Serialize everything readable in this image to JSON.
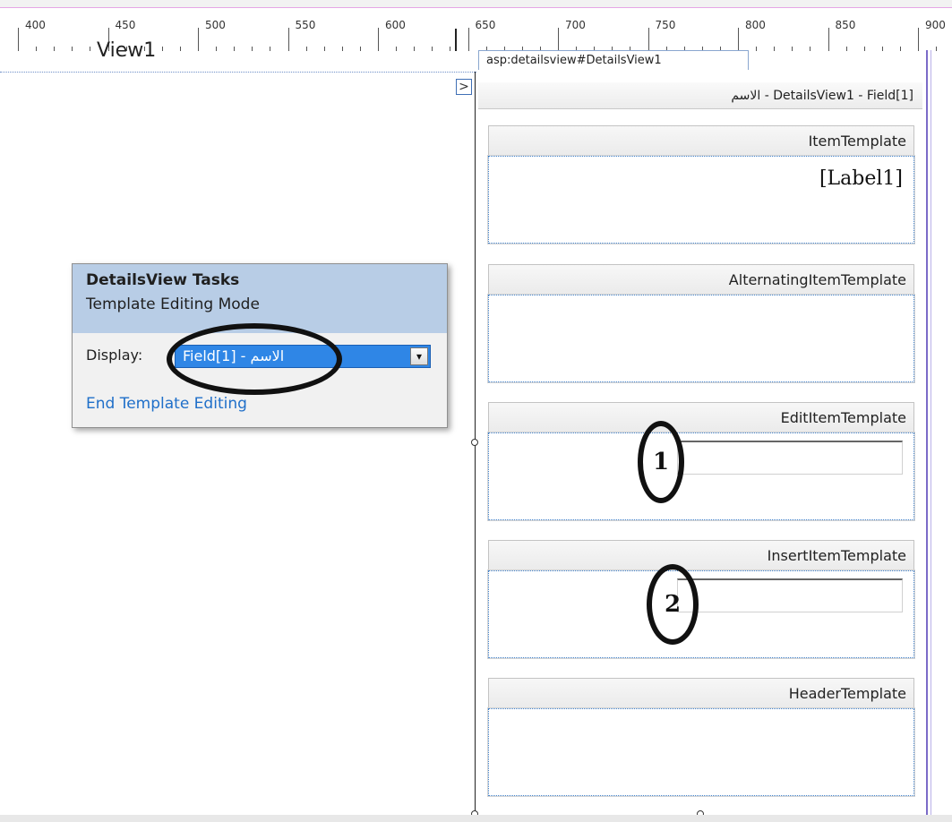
{
  "ruler": {
    "labels": [
      "400",
      "450",
      "500",
      "550",
      "600",
      "650",
      "700",
      "750",
      "800",
      "850",
      "900"
    ]
  },
  "designer": {
    "view_caption": "View1",
    "control_tab": "asp:detailsview#DetailsView1",
    "smart_tag_glyph": ">",
    "control_header": "DetailsView1 - Field[1] - الاسم",
    "templates": [
      {
        "title": "ItemTemplate",
        "content": "[Label1]"
      },
      {
        "title": "AlternatingItemTemplate",
        "content": ""
      },
      {
        "title": "EditItemTemplate",
        "content": ""
      },
      {
        "title": "InsertItemTemplate",
        "content": ""
      },
      {
        "title": "HeaderTemplate",
        "content": ""
      }
    ],
    "annotations": {
      "edit_number": "1",
      "insert_number": "2"
    }
  },
  "tasks_panel": {
    "title": "DetailsView Tasks",
    "mode": "Template Editing Mode",
    "display_label": "Display:",
    "display_value": "Field[1] - الاسم",
    "dropdown_glyph": "▾",
    "end_link": "End Template Editing"
  },
  "colors": {
    "tasks_header": "#b8cde6",
    "select_highlight": "#2f86e6",
    "link": "#1f6fc9",
    "guide_line": "#7b6bc8"
  }
}
